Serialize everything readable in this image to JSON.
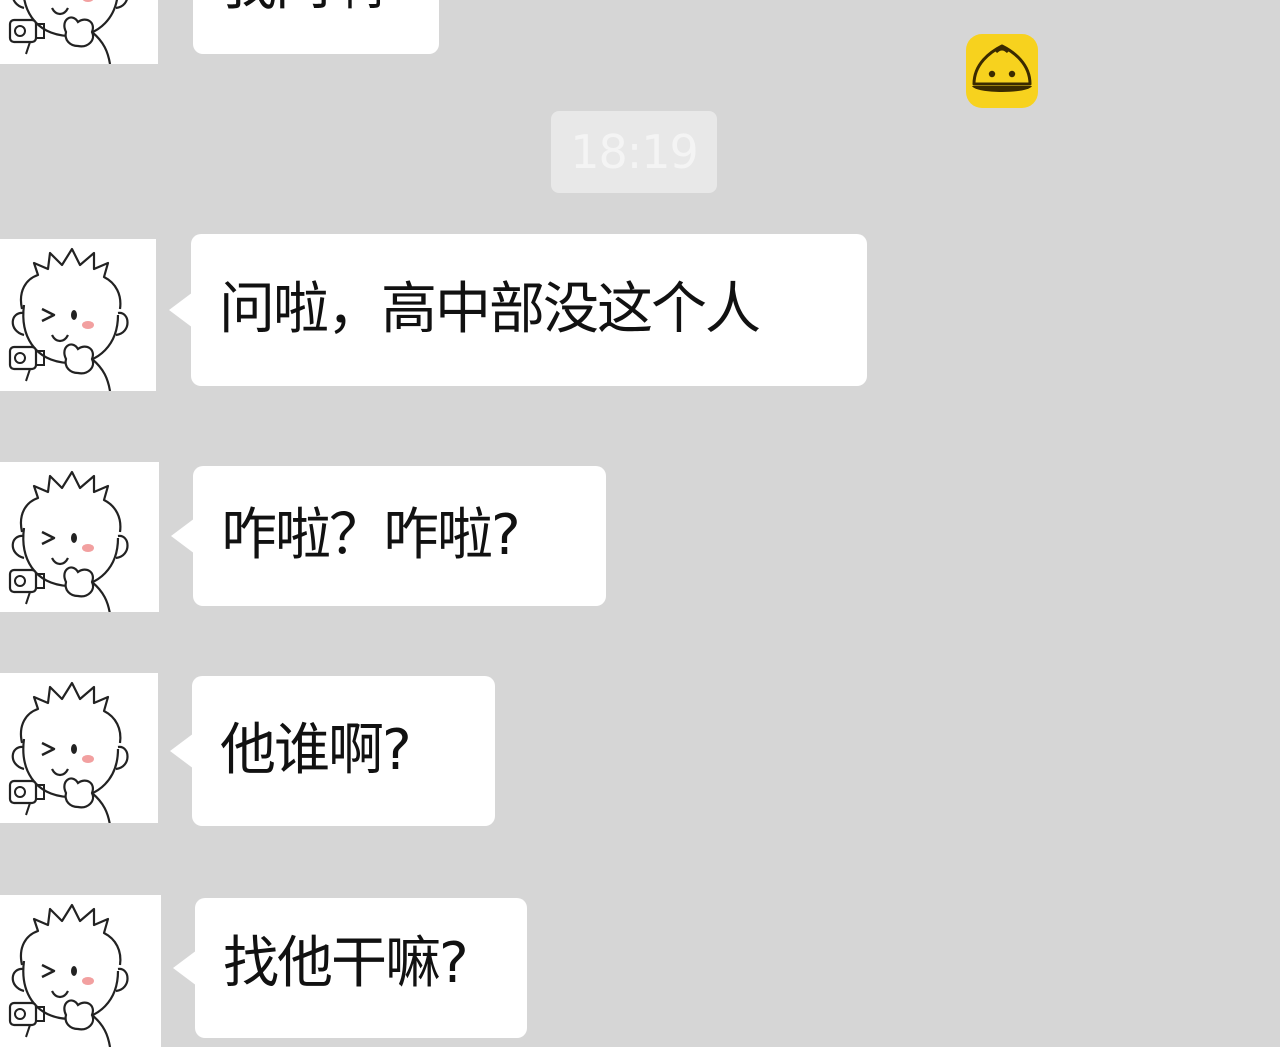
{
  "timestamp": "18:19",
  "watermark": {
    "logo_icon": "bun-logo-icon",
    "text": "",
    "subtext": ""
  },
  "messages": [
    {
      "text": "我问啊",
      "sender": "friend",
      "avatar": "cartoon-boy-avatar"
    },
    {
      "text": "问啦，高中部没这个人",
      "sender": "friend",
      "avatar": "cartoon-boy-avatar"
    },
    {
      "text": "咋啦？咋啦?",
      "sender": "friend",
      "avatar": "cartoon-boy-avatar"
    },
    {
      "text": "他谁啊?",
      "sender": "friend",
      "avatar": "cartoon-boy-avatar"
    },
    {
      "text": "找他干嘛?",
      "sender": "friend",
      "avatar": "cartoon-boy-avatar"
    }
  ],
  "colors": {
    "background": "#d6d6d6",
    "bubble": "#ffffff",
    "text": "#111111",
    "logo": "#f7d21e"
  }
}
